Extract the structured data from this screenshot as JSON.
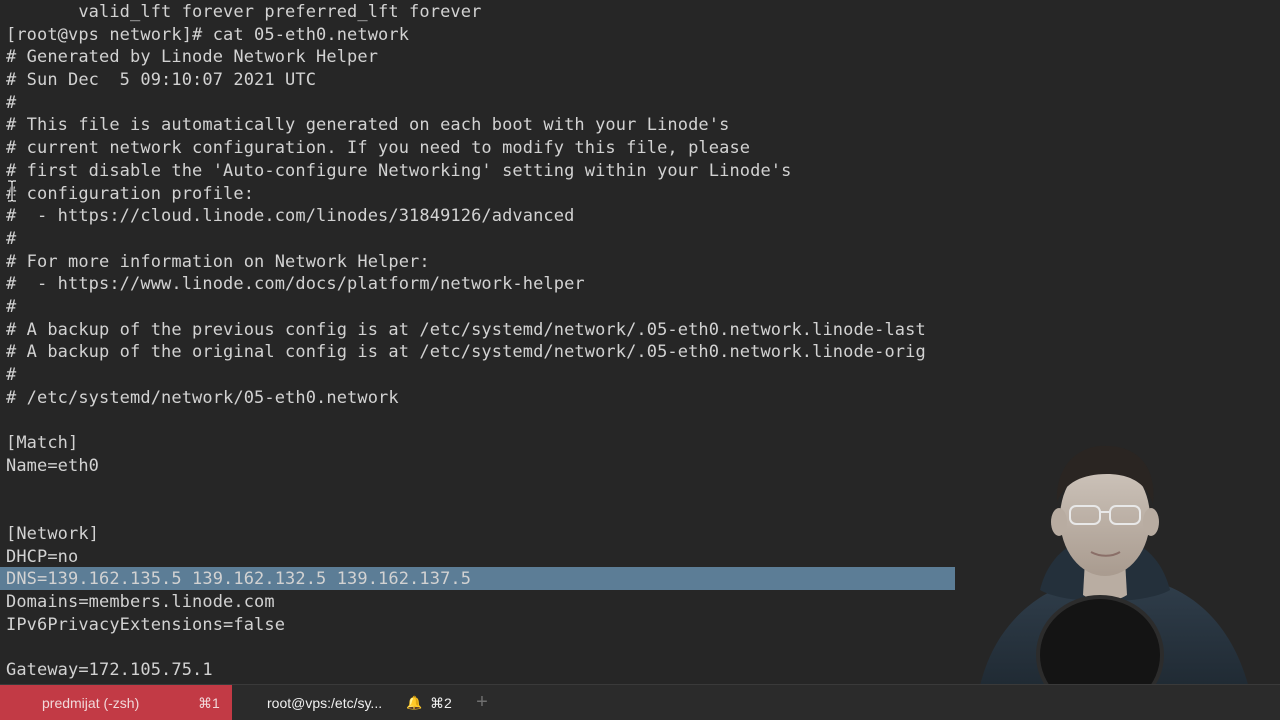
{
  "terminal": {
    "lines": [
      "       valid_lft forever preferred_lft forever",
      "[root@vps network]# cat 05-eth0.network",
      "# Generated by Linode Network Helper",
      "# Sun Dec  5 09:10:07 2021 UTC",
      "#",
      "# This file is automatically generated on each boot with your Linode's",
      "# current network configuration. If you need to modify this file, please",
      "# first disable the 'Auto-configure Networking' setting within your Linode's",
      "# configuration profile:",
      "#  - https://cloud.linode.com/linodes/31849126/advanced",
      "#",
      "# For more information on Network Helper:",
      "#  - https://www.linode.com/docs/platform/network-helper",
      "#",
      "# A backup of the previous config is at /etc/systemd/network/.05-eth0.network.linode-last",
      "# A backup of the original config is at /etc/systemd/network/.05-eth0.network.linode-orig",
      "#",
      "# /etc/systemd/network/05-eth0.network",
      "",
      "[Match]",
      "Name=eth0",
      "",
      "",
      "[Network]",
      "DHCP=no",
      "DNS=139.162.135.5 139.162.132.5 139.162.137.5",
      "Domains=members.linode.com",
      "IPv6PrivacyExtensions=false",
      "",
      "Gateway=172.105.75.1"
    ],
    "selected_line_index": 25
  },
  "tabs": [
    {
      "title": "predmijat (-zsh)",
      "shortcut": "⌘1",
      "active": false,
      "color": "#c23a45"
    },
    {
      "title": "root@vps:/etc/sy...",
      "shortcut": "⌘2",
      "active": true,
      "bell_icon": "bell-icon"
    }
  ],
  "new_tab_icon": "plus-icon",
  "colors": {
    "terminal_bg": "#262626",
    "terminal_fg": "#d2d2d2",
    "selection": "#5c7d96",
    "tab_red": "#c23a45"
  }
}
